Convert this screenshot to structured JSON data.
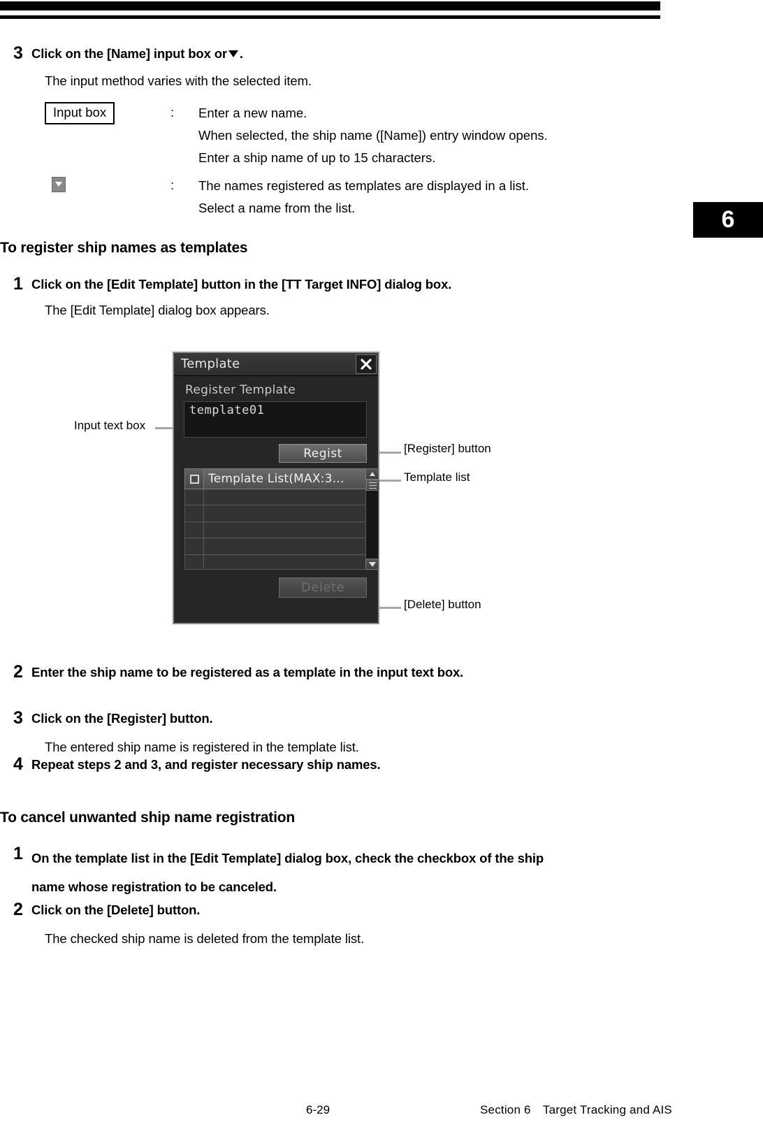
{
  "page": {
    "chapter_tab": "6",
    "footer_page_number": "6-29",
    "footer_section": "Section 6 Target Tracking and AIS"
  },
  "step3_top": {
    "number": "3",
    "title_before": "Click on the [Name] input box or",
    "title_after": ".",
    "subtitle": "The input method varies with the selected item.",
    "definitions": [
      {
        "term": "Input box",
        "term_type": "boxed-label",
        "colon": ":",
        "lines": [
          "Enter a new name.",
          "When selected, the ship name ([Name]) entry window opens.",
          "Enter a ship name of up to 15 characters."
        ]
      },
      {
        "term": "",
        "term_type": "dropdown-glyph",
        "colon": ":",
        "lines": [
          "The names registered as templates are displayed in a list.",
          "Select a name from the list."
        ]
      }
    ]
  },
  "section_register": {
    "heading": "To register ship names as templates",
    "steps": [
      {
        "number": "1",
        "title": "Click on the [Edit Template] button in the [TT Target INFO] dialog box.",
        "body": "The [Edit Template] dialog box appears."
      },
      {
        "number": "2",
        "title": "Enter the ship name to be registered as a template in the input text box.",
        "body": ""
      },
      {
        "number": "3",
        "title": "Click on the [Register] button.",
        "body": "The entered ship name is registered in the template list."
      },
      {
        "number": "4",
        "title": "Repeat steps 2 and 3, and register necessary ship names.",
        "body": ""
      }
    ]
  },
  "section_cancel": {
    "heading": "To cancel unwanted ship name registration",
    "steps": [
      {
        "number": "1",
        "title_line1": "On the template list in the [Edit Template] dialog box, check the checkbox of the ship",
        "title_line2": "name whose registration to be canceled.",
        "body": ""
      },
      {
        "number": "2",
        "title": "Click on the [Delete] button.",
        "body": "The checked ship name is deleted from the template list."
      }
    ]
  },
  "figure": {
    "dialog": {
      "title": "Template",
      "close_icon": "close-icon",
      "register_group_label": "Register Template",
      "input_value": "template01",
      "regist_button": "Regist",
      "list_header": "Template List(MAX:3…",
      "list_row_count": 5,
      "delete_button": "Delete",
      "scrollbar": {
        "up_icon": "chevron-up-icon",
        "down_icon": "chevron-down-icon",
        "thumb_icon": "scroll-thumb-grip"
      }
    },
    "callouts": {
      "input_text_box": "Input text box",
      "register_button": "[Register] button",
      "template_list": "Template list",
      "delete_button": "[Delete] button"
    }
  }
}
